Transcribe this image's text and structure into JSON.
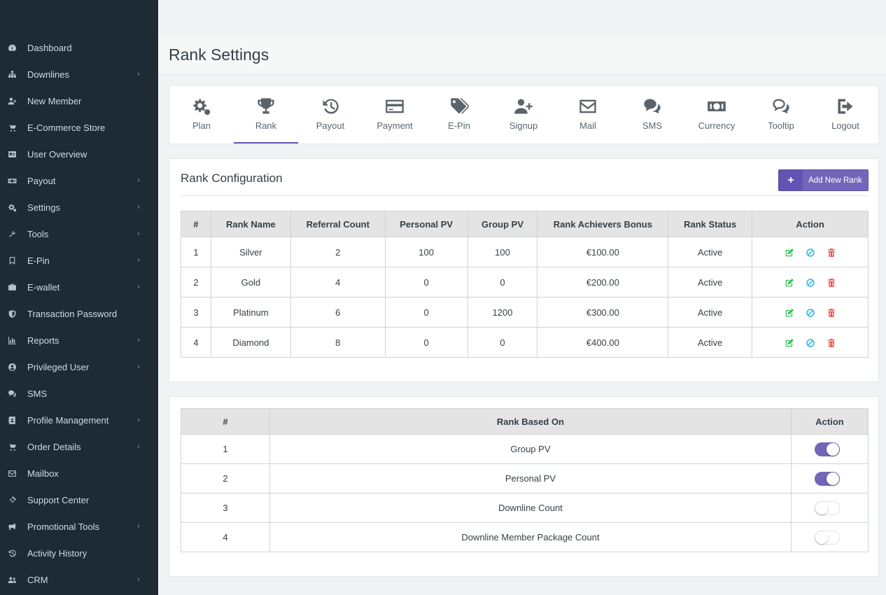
{
  "sidebar": {
    "items": [
      {
        "label": "Dashboard",
        "icon": "dashboard-icon",
        "has_children": false
      },
      {
        "label": "Downlines",
        "icon": "sitemap-icon",
        "has_children": true
      },
      {
        "label": "New Member",
        "icon": "user-plus-icon",
        "has_children": false
      },
      {
        "label": "E-Commerce Store",
        "icon": "cart-icon",
        "has_children": false
      },
      {
        "label": "User Overview",
        "icon": "id-card-icon",
        "has_children": false
      },
      {
        "label": "Payout",
        "icon": "money-icon",
        "has_children": true
      },
      {
        "label": "Settings",
        "icon": "cogs-icon",
        "has_children": true
      },
      {
        "label": "Tools",
        "icon": "wrench-icon",
        "has_children": true
      },
      {
        "label": "E-Pin",
        "icon": "bookmark-icon",
        "has_children": true
      },
      {
        "label": "E-wallet",
        "icon": "briefcase-icon",
        "has_children": true
      },
      {
        "label": "Transaction Password",
        "icon": "shield-icon",
        "has_children": false
      },
      {
        "label": "Reports",
        "icon": "bar-chart-icon",
        "has_children": true
      },
      {
        "label": "Privileged User",
        "icon": "user-circle-icon",
        "has_children": true
      },
      {
        "label": "SMS",
        "icon": "comments-icon",
        "has_children": false
      },
      {
        "label": "Profile Management",
        "icon": "address-book-icon",
        "has_children": true
      },
      {
        "label": "Order Details",
        "icon": "cart-icon",
        "has_children": true
      },
      {
        "label": "Mailbox",
        "icon": "envelope-icon",
        "has_children": false
      },
      {
        "label": "Support Center",
        "icon": "ticket-icon",
        "has_children": false
      },
      {
        "label": "Promotional Tools",
        "icon": "bullhorn-icon",
        "has_children": true
      },
      {
        "label": "Activity History",
        "icon": "history-icon",
        "has_children": false
      },
      {
        "label": "CRM",
        "icon": "users-icon",
        "has_children": true
      }
    ]
  },
  "page": {
    "title": "Rank Settings"
  },
  "tabs": [
    {
      "label": "Plan",
      "icon": "cogs-icon"
    },
    {
      "label": "Rank",
      "icon": "trophy-icon",
      "active": true
    },
    {
      "label": "Payout",
      "icon": "history-icon"
    },
    {
      "label": "Payment",
      "icon": "credit-card-icon"
    },
    {
      "label": "E-Pin",
      "icon": "tags-icon"
    },
    {
      "label": "Signup",
      "icon": "user-plus-icon"
    },
    {
      "label": "Mail",
      "icon": "envelope-icon"
    },
    {
      "label": "SMS",
      "icon": "comments-icon"
    },
    {
      "label": "Currency",
      "icon": "money-icon"
    },
    {
      "label": "Tooltip",
      "icon": "comments-outline-icon"
    },
    {
      "label": "Logout",
      "icon": "sign-out-icon"
    }
  ],
  "rank_config": {
    "title": "Rank Configuration",
    "add_button": "Add New Rank",
    "columns": [
      "#",
      "Rank Name",
      "Referral Count",
      "Personal PV",
      "Group PV",
      "Rank Achievers Bonus",
      "Rank Status",
      "Action"
    ],
    "rows": [
      {
        "num": "1",
        "name": "Silver",
        "referral": "2",
        "personal_pv": "100",
        "group_pv": "100",
        "bonus": "€100.00",
        "status": "Active"
      },
      {
        "num": "2",
        "name": "Gold",
        "referral": "4",
        "personal_pv": "0",
        "group_pv": "0",
        "bonus": "€200.00",
        "status": "Active"
      },
      {
        "num": "3",
        "name": "Platinum",
        "referral": "6",
        "personal_pv": "0",
        "group_pv": "1200",
        "bonus": "€300.00",
        "status": "Active"
      },
      {
        "num": "4",
        "name": "Diamond",
        "referral": "8",
        "personal_pv": "0",
        "group_pv": "0",
        "bonus": "€400.00",
        "status": "Active"
      }
    ]
  },
  "rank_based": {
    "columns": [
      "#",
      "Rank Based On",
      "Action"
    ],
    "rows": [
      {
        "num": "1",
        "label": "Group PV",
        "enabled": true
      },
      {
        "num": "2",
        "label": "Personal PV",
        "enabled": true
      },
      {
        "num": "3",
        "label": "Downline Count",
        "enabled": false
      },
      {
        "num": "4",
        "label": "Downline Member Package Count",
        "enabled": false
      }
    ]
  },
  "colors": {
    "sidebar_bg": "#1c2b36",
    "accent": "#7266ba",
    "edit": "#27c24c",
    "block": "#23b7e5",
    "delete": "#f05050"
  }
}
